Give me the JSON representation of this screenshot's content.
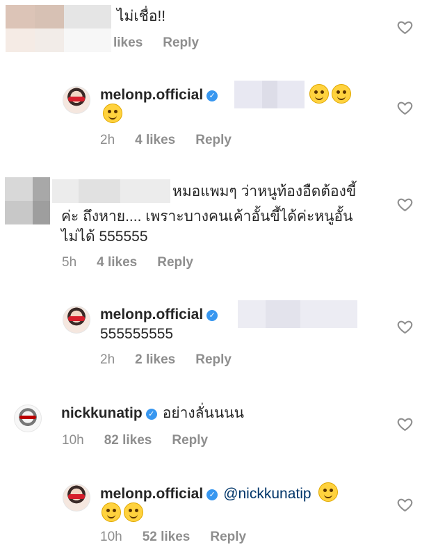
{
  "comments": [
    {
      "username": "",
      "text": "ไม่เชื่อ!!",
      "likes": "likes",
      "reply": "Reply"
    },
    {
      "username": "melonp.official",
      "text_suffix": "",
      "time": "2h",
      "likes": "4 likes",
      "reply": "Reply"
    },
    {
      "line1": "หมอแพมๆ ว่าหนูท้องอืดต้องขี้",
      "line2": "ค่ะ ถึงหาย.... เพราะบางคนเค้าอั้นขี้ได้ค่ะหนูอั้น",
      "line3": "ไม่ได้ 555555",
      "time": "5h",
      "likes": "4 likes",
      "reply": "Reply"
    },
    {
      "username": "melonp.official",
      "text": "555555555",
      "time": "2h",
      "likes": "2 likes",
      "reply": "Reply"
    },
    {
      "username": "nickkunatip",
      "text": "อย่างลั่นนนน",
      "time": "10h",
      "likes": "82 likes",
      "reply": "Reply"
    },
    {
      "username": "melonp.official",
      "mention": "@nickkunatip",
      "time": "10h",
      "likes": "52 likes",
      "reply": "Reply"
    }
  ],
  "icons": {
    "verified": "verified-badge-icon",
    "like": "heart-outline-icon",
    "emoji_crazy": "zany-face-emoji",
    "emoji_smile": "smiling-face-emoji"
  },
  "colors": {
    "verified": "#3897f0",
    "meta": "#8e8e8e",
    "mention": "#003569"
  }
}
